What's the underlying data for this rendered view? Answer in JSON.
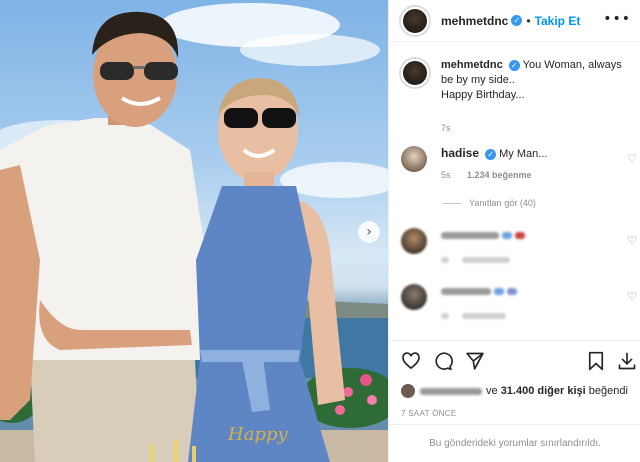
{
  "post": {
    "author": "mehmetdnc",
    "follow_label": "Takip Et",
    "header_separator": "•",
    "more_label": "•••",
    "caption_line1": "You Woman, always be by my side..",
    "caption_line2": "Happy Birthday...",
    "caption_time": "7s",
    "view_replies": "Yanıtları gör (40)",
    "likes_prefix": "ve",
    "likes_count": "31.400 diğer kişi",
    "likes_suffix": "beğendi",
    "time_ago": "7 SAAT ÖNCE",
    "comments_restricted": "Bu gönderideki yorumlar sınırlandırıldı.",
    "accent_color": "#0095f6",
    "verified_color": "#3897f0",
    "next_icon": "chevron-right-icon"
  },
  "comments": [
    {
      "user": "hadise",
      "text": "My Man...",
      "time": "5s",
      "likes": "1.234 beğenme"
    }
  ],
  "photo": {
    "cake_text": "Happy",
    "verified_mark": "✓",
    "next_arrow": "›",
    "heart_small": "♡"
  }
}
